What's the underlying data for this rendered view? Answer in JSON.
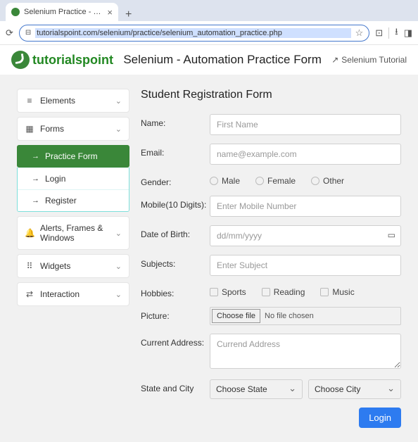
{
  "browser": {
    "tab_title": "Selenium Practice - Student F",
    "url": "tutorialspoint.com/selenium/practice/selenium_automation_practice.php"
  },
  "header": {
    "brand_green": "tutorials",
    "brand_black": "point",
    "title": "Selenium - Automation Practice Form",
    "tutorial_link": "Selenium Tutorial"
  },
  "sidebar": {
    "items": [
      {
        "icon": "≡",
        "label": "Elements"
      },
      {
        "icon": "▦",
        "label": "Forms"
      },
      {
        "icon": "🔔",
        "label": "Alerts, Frames & Windows"
      },
      {
        "icon": "⠿",
        "label": "Widgets"
      },
      {
        "icon": "⇄",
        "label": "Interaction"
      }
    ],
    "forms_sub": {
      "practice": "Practice Form",
      "login": "Login",
      "register": "Register"
    }
  },
  "form": {
    "title": "Student Registration Form",
    "labels": {
      "name": "Name:",
      "email": "Email:",
      "gender": "Gender:",
      "mobile": "Mobile(10 Digits):",
      "dob": "Date of Birth:",
      "subjects": "Subjects:",
      "hobbies": "Hobbies:",
      "picture": "Picture:",
      "address": "Current Address:",
      "state_city": "State and City"
    },
    "placeholders": {
      "name": "First Name",
      "email": "name@example.com",
      "mobile": "Enter Mobile Number",
      "dob": "dd/mm/yyyy",
      "subjects": "Enter Subject",
      "address": "Currend Address"
    },
    "gender": {
      "male": "Male",
      "female": "Female",
      "other": "Other"
    },
    "hobbies": {
      "sports": "Sports",
      "reading": "Reading",
      "music": "Music"
    },
    "file": {
      "button": "Choose file",
      "status": "No file chosen"
    },
    "selects": {
      "state": "Choose State",
      "city": "Choose City"
    },
    "submit": "Login"
  }
}
